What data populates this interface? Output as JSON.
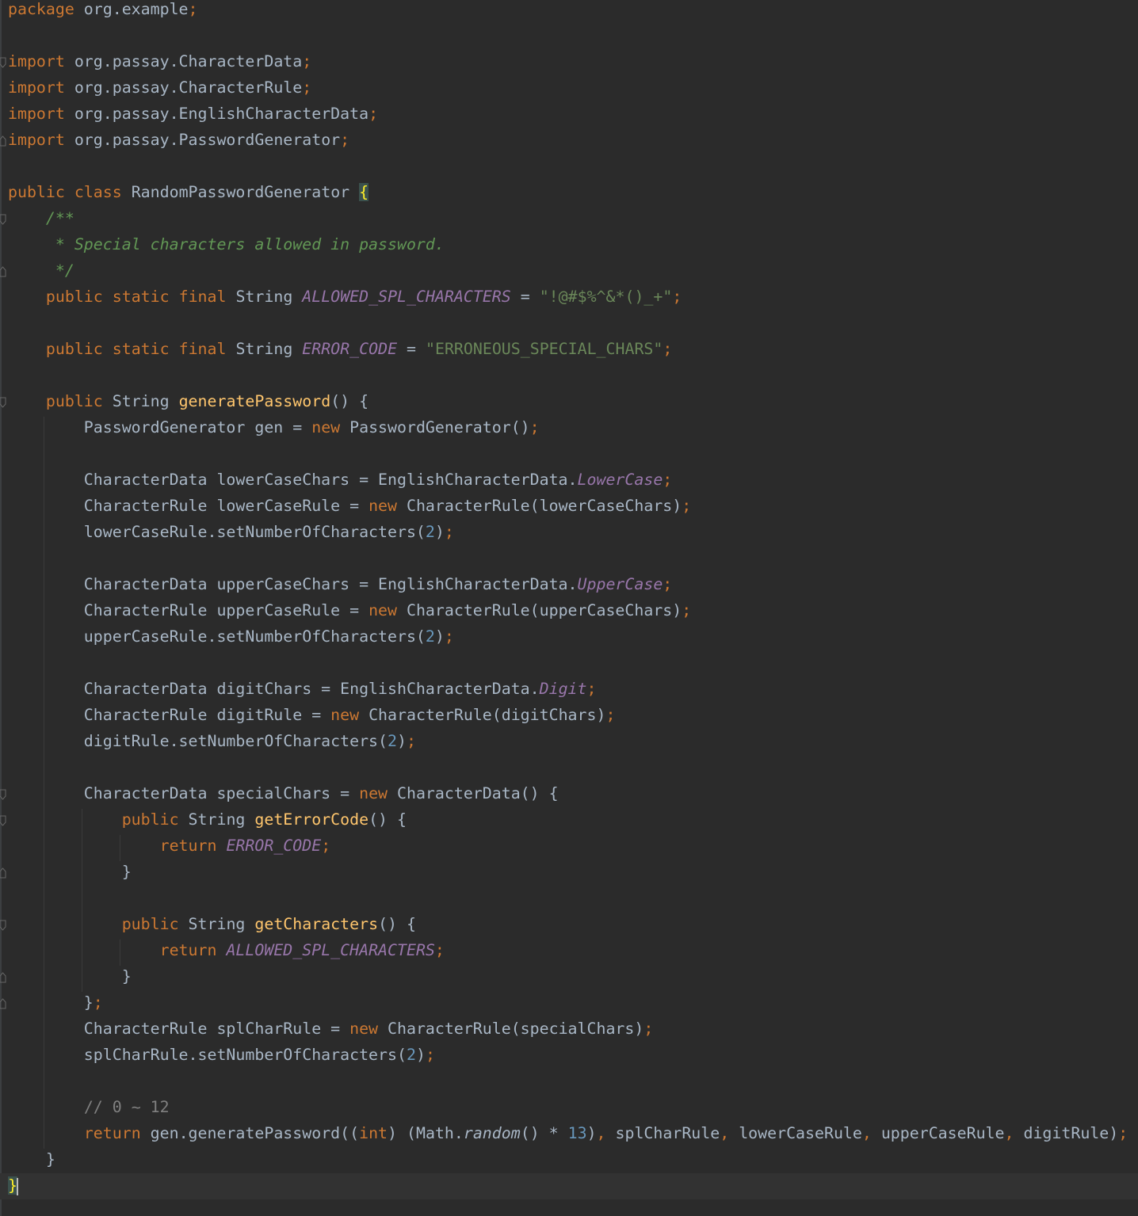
{
  "editor": {
    "language": "Java",
    "file_class": "RandomPasswordGenerator",
    "colors": {
      "background": "#2b2b2b",
      "keyword": "#cc7832",
      "string": "#6a8759",
      "number": "#6897bb",
      "method": "#ffc66d",
      "constant": "#9876aa",
      "comment": "#629755",
      "line_comment": "#808080",
      "default_text": "#a9b7c6"
    },
    "code_lines": [
      "package org.example;",
      "",
      "import org.passay.CharacterData;",
      "import org.passay.CharacterRule;",
      "import org.passay.EnglishCharacterData;",
      "import org.passay.PasswordGenerator;",
      "",
      "public class RandomPasswordGenerator {",
      "    /**",
      "     * Special characters allowed in password.",
      "     */",
      "    public static final String ALLOWED_SPL_CHARACTERS = \"!@#$%^&*()_+\";",
      "",
      "    public static final String ERROR_CODE = \"ERRONEOUS_SPECIAL_CHARS\";",
      "",
      "    public String generatePassword() {",
      "        PasswordGenerator gen = new PasswordGenerator();",
      "",
      "        CharacterData lowerCaseChars = EnglishCharacterData.LowerCase;",
      "        CharacterRule lowerCaseRule = new CharacterRule(lowerCaseChars);",
      "        lowerCaseRule.setNumberOfCharacters(2);",
      "",
      "        CharacterData upperCaseChars = EnglishCharacterData.UpperCase;",
      "        CharacterRule upperCaseRule = new CharacterRule(upperCaseChars);",
      "        upperCaseRule.setNumberOfCharacters(2);",
      "",
      "        CharacterData digitChars = EnglishCharacterData.Digit;",
      "        CharacterRule digitRule = new CharacterRule(digitChars);",
      "        digitRule.setNumberOfCharacters(2);",
      "",
      "        CharacterData specialChars = new CharacterData() {",
      "            public String getErrorCode() {",
      "                return ERROR_CODE;",
      "            }",
      "",
      "            public String getCharacters() {",
      "                return ALLOWED_SPL_CHARACTERS;",
      "            }",
      "        };",
      "        CharacterRule splCharRule = new CharacterRule(specialChars);",
      "        splCharRule.setNumberOfCharacters(2);",
      "",
      "        // 0 ~ 12",
      "        return gen.generatePassword((int) (Math.random() * 13), splCharRule, lowerCaseRule, upperCaseRule, digitRule);",
      "    }",
      "}"
    ]
  }
}
